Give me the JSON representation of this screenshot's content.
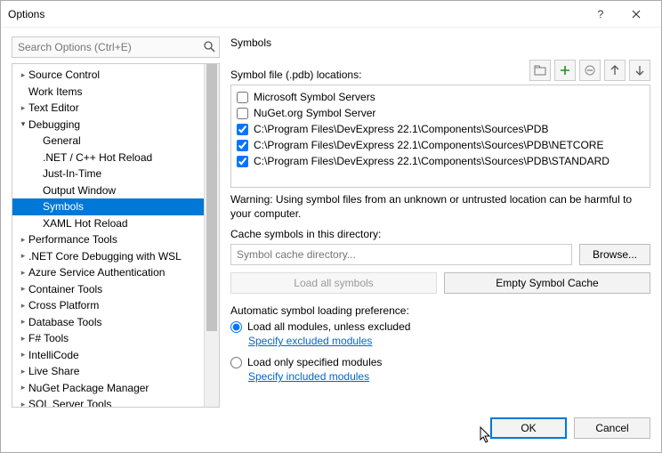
{
  "window": {
    "title": "Options"
  },
  "search": {
    "placeholder": "Search Options (Ctrl+E)"
  },
  "tree": {
    "items": [
      {
        "label": "Source Control",
        "level": 0,
        "arrow": ">"
      },
      {
        "label": "Work Items",
        "level": 0,
        "arrow": ""
      },
      {
        "label": "Text Editor",
        "level": 0,
        "arrow": ">"
      },
      {
        "label": "Debugging",
        "level": 0,
        "arrow": "v"
      },
      {
        "label": "General",
        "level": 1,
        "arrow": ""
      },
      {
        "label": ".NET / C++ Hot Reload",
        "level": 1,
        "arrow": ""
      },
      {
        "label": "Just-In-Time",
        "level": 1,
        "arrow": ""
      },
      {
        "label": "Output Window",
        "level": 1,
        "arrow": ""
      },
      {
        "label": "Symbols",
        "level": 1,
        "arrow": "",
        "selected": true
      },
      {
        "label": "XAML Hot Reload",
        "level": 1,
        "arrow": ""
      },
      {
        "label": "Performance Tools",
        "level": 0,
        "arrow": ">"
      },
      {
        "label": ".NET Core Debugging with WSL",
        "level": 0,
        "arrow": ">"
      },
      {
        "label": "Azure Service Authentication",
        "level": 0,
        "arrow": ">"
      },
      {
        "label": "Container Tools",
        "level": 0,
        "arrow": ">"
      },
      {
        "label": "Cross Platform",
        "level": 0,
        "arrow": ">"
      },
      {
        "label": "Database Tools",
        "level": 0,
        "arrow": ">"
      },
      {
        "label": "F# Tools",
        "level": 0,
        "arrow": ">"
      },
      {
        "label": "IntelliCode",
        "level": 0,
        "arrow": ">"
      },
      {
        "label": "Live Share",
        "level": 0,
        "arrow": ">"
      },
      {
        "label": "NuGet Package Manager",
        "level": 0,
        "arrow": ">"
      },
      {
        "label": "SQL Server Tools",
        "level": 0,
        "arrow": ">"
      }
    ]
  },
  "panel": {
    "heading": "Symbols",
    "locations_label": "Symbol file (.pdb) locations:",
    "icons": {
      "new": "new-folder",
      "add": "add",
      "remove": "remove",
      "up": "up",
      "down": "down"
    },
    "locations": [
      {
        "label": "Microsoft Symbol Servers",
        "checked": false
      },
      {
        "label": "NuGet.org Symbol Server",
        "checked": false
      },
      {
        "label": "C:\\Program Files\\DevExpress 22.1\\Components\\Sources\\PDB",
        "checked": true
      },
      {
        "label": "C:\\Program Files\\DevExpress 22.1\\Components\\Sources\\PDB\\NETCORE",
        "checked": true
      },
      {
        "label": "C:\\Program Files\\DevExpress 22.1\\Components\\Sources\\PDB\\STANDARD",
        "checked": true
      }
    ],
    "warning": "Warning: Using symbol files from an unknown or untrusted location can be harmful to your computer.",
    "cache_label": "Cache symbols in this directory:",
    "cache_placeholder": "Symbol cache directory...",
    "browse_btn": "Browse...",
    "load_all_btn": "Load all symbols",
    "empty_cache_btn": "Empty Symbol Cache",
    "auto_label": "Automatic symbol loading preference:",
    "radio1": "Load all modules, unless excluded",
    "link1": "Specify excluded modules",
    "radio2": "Load only specified modules",
    "link2": "Specify included modules"
  },
  "footer": {
    "ok": "OK",
    "cancel": "Cancel"
  }
}
